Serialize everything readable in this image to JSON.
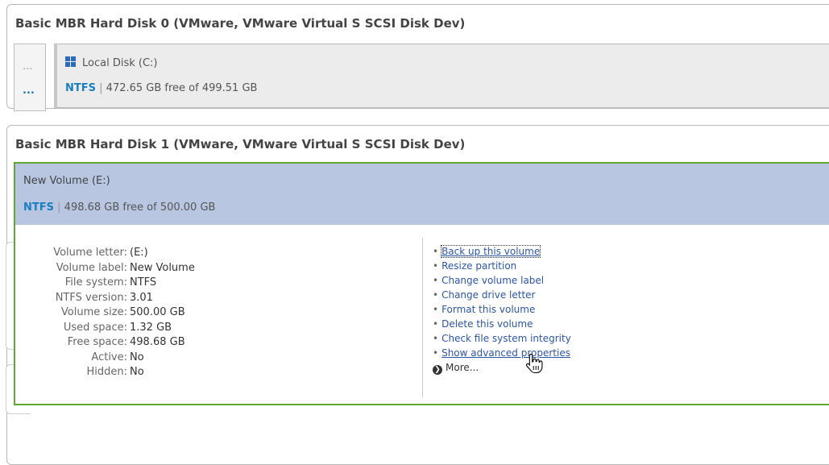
{
  "disks": [
    {
      "title": "Basic MBR Hard Disk 0 (VMware, VMware Virtual S SCSI Disk Dev)",
      "side_dots": [
        "...",
        "..."
      ],
      "volume": {
        "name": "Local Disk (C:)",
        "fs": "NTFS",
        "sep": "|",
        "space": "472.65 GB free of 499.51 GB"
      }
    },
    {
      "title": "Basic MBR Hard Disk 1 (VMware, VMware Virtual S SCSI Disk Dev)",
      "volume": {
        "name": "New Volume (E:)",
        "fs": "NTFS",
        "sep": "|",
        "space": "498.68 GB free of 500.00 GB"
      }
    }
  ],
  "properties": [
    {
      "key": "Volume letter:",
      "value": "(E:)"
    },
    {
      "key": "Volume label:",
      "value": "New Volume"
    },
    {
      "key": "File system:",
      "value": "NTFS"
    },
    {
      "key": "NTFS version:",
      "value": "3.01"
    },
    {
      "key": "Volume size:",
      "value": "500.00 GB"
    },
    {
      "key": "Used space:",
      "value": "1.32 GB"
    },
    {
      "key": "Free space:",
      "value": "498.68 GB"
    },
    {
      "key": "Active:",
      "value": "No"
    },
    {
      "key": "Hidden:",
      "value": "No"
    }
  ],
  "actions": {
    "bullet": "•",
    "items": [
      "Back up this volume",
      "Resize partition",
      "Change volume label",
      "Change drive letter",
      "Format this volume",
      "Delete this volume",
      "Check file system integrity",
      "Show advanced properties"
    ],
    "more_label": "More...",
    "more_icon": "❯"
  },
  "colors": {
    "selection_border": "#5fa832",
    "selection_header": "#b8c6e2",
    "link": "#2c56a7",
    "fs_label": "#1a7fbf"
  }
}
